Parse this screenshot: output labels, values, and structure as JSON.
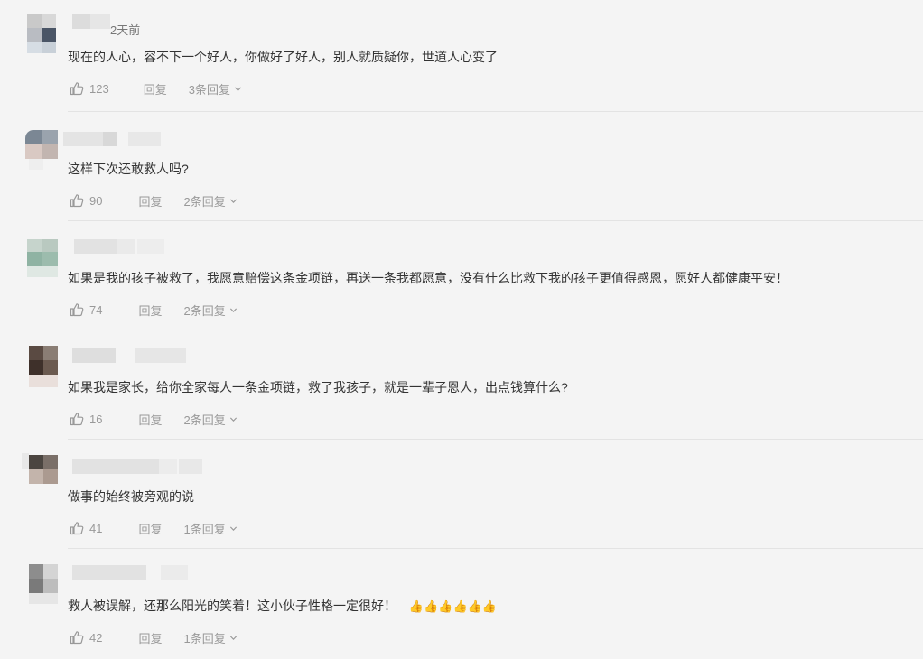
{
  "comments": [
    {
      "time": "2天前",
      "text": "现在的人心，容不下一个好人，你做好了好人，别人就质疑你，世道人心变了",
      "likes": "123",
      "reply_label": "回复",
      "replies_label": "3条回复",
      "emoji": ""
    },
    {
      "time": "",
      "text": "这样下次还敢救人吗?",
      "likes": "90",
      "reply_label": "回复",
      "replies_label": "2条回复",
      "emoji": ""
    },
    {
      "time": "",
      "text": "如果是我的孩子被救了，我愿意赔偿这条金项链，再送一条我都愿意，没有什么比救下我的孩子更值得感恩，愿好人都健康平安！",
      "likes": "74",
      "reply_label": "回复",
      "replies_label": "2条回复",
      "emoji": ""
    },
    {
      "time": "",
      "text": "如果我是家长，给你全家每人一条金项链，救了我孩子，就是一辈子恩人，出点钱算什么?",
      "likes": "16",
      "reply_label": "回复",
      "replies_label": "2条回复",
      "emoji": ""
    },
    {
      "time": "",
      "text": "做事的始终被旁观的说",
      "likes": "41",
      "reply_label": "回复",
      "replies_label": "1条回复",
      "emoji": ""
    },
    {
      "time": "",
      "text": "救人被误解，还那么阳光的笑着！这小伙子性格一定很好！",
      "likes": "42",
      "reply_label": "回复",
      "replies_label": "1条回复",
      "emoji": "👍👍👍👍👍👍"
    }
  ],
  "icons": {
    "like": "thumbs-up-icon",
    "expand": "chevron-down-icon"
  },
  "colors": {
    "background": "#f4f4f4",
    "text": "#333333",
    "muted": "#999999",
    "divider": "#e3e3e3"
  }
}
